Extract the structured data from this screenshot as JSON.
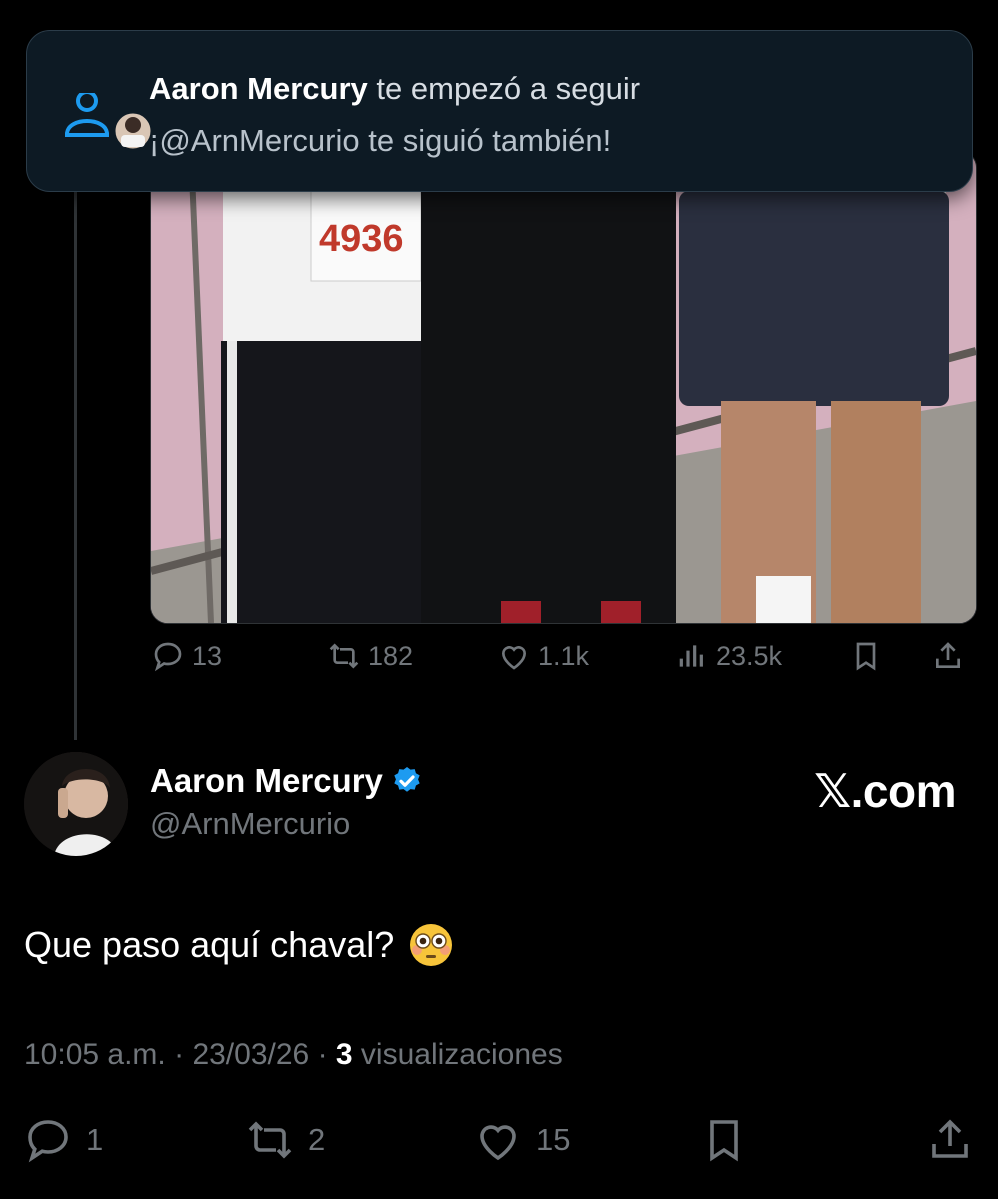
{
  "notification": {
    "name": "Aaron Mercury",
    "action": "te empezó a seguir",
    "follow_back": "¡@ArnMercurio te siguió también!"
  },
  "quoted_post": {
    "bib_number": "4936",
    "stats": {
      "replies": "13",
      "reposts": "182",
      "likes": "1.1k",
      "views": "23.5k"
    }
  },
  "author": {
    "name": "Aaron Mercury",
    "handle": "@ArnMercurio",
    "verified": true
  },
  "watermark": "𝕏.com",
  "tweet": {
    "text": "Que paso aquí chaval?",
    "emoji": "flushed-face"
  },
  "meta": {
    "time": "10:05 a.m.",
    "date": "23/03/26",
    "views_count": "3",
    "views_label": "visualizaciones"
  },
  "actions": {
    "replies": "1",
    "reposts": "2",
    "likes": "15"
  },
  "colors": {
    "background": "#000000",
    "muted": "#71767b",
    "accent": "#1d9bf0",
    "notification_bg": "#0d1a24"
  }
}
